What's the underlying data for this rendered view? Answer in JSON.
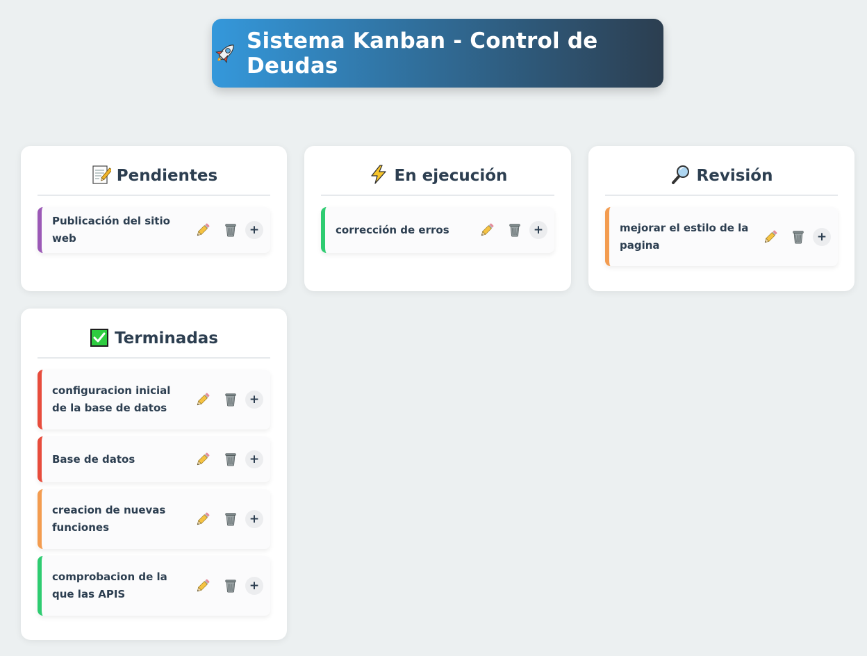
{
  "header": {
    "title": "Sistema Kanban - Control de Deudas",
    "icon": "rocket-icon"
  },
  "colors": {
    "purple": "#9b59b6",
    "green": "#2ecc71",
    "orange": "#f39c50",
    "red": "#e74c3c",
    "header_start": "#3498db",
    "header_end": "#2c3e50"
  },
  "columns": [
    {
      "title": "Pendientes",
      "icon": "memo-icon",
      "tasks": [
        {
          "text": "Publicación del sitio web",
          "color": "#9b59b6"
        }
      ]
    },
    {
      "title": "En ejecución",
      "icon": "lightning-icon",
      "tasks": [
        {
          "text": "corrección de erros",
          "color": "#2ecc71"
        }
      ]
    },
    {
      "title": "Revisión",
      "icon": "magnifier-icon",
      "tasks": [
        {
          "text": "mejorar el estilo de la pagina",
          "color": "#f39c50"
        }
      ]
    },
    {
      "title": "Terminadas",
      "icon": "check-box-icon",
      "tasks": [
        {
          "text": "configuracion inicial de la base de datos",
          "color": "#e74c3c"
        },
        {
          "text": "Base de datos",
          "color": "#e74c3c"
        },
        {
          "text": "creacion de nuevas funciones",
          "color": "#f39c50"
        },
        {
          "text": "comprobacion de la que las APIS",
          "color": "#2ecc71"
        }
      ]
    }
  ],
  "actions": {
    "edit": "edit-pencil-icon",
    "delete": "trash-icon",
    "add_label": "+"
  }
}
